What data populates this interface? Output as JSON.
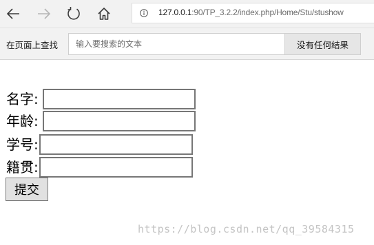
{
  "browser": {
    "url_host": "127.0.0.1",
    "url_rest": ":90/TP_3.2.2/index.php/Home/Stu/stushow"
  },
  "findbar": {
    "label": "在页面上查找",
    "placeholder": "输入要搜索的文本",
    "result": "没有任何结果"
  },
  "form": {
    "name_label": "名字:",
    "age_label": "年龄:",
    "student_id_label": "学号:",
    "hometown_label": "籍贯:",
    "submit_label": "提交"
  },
  "watermark": "https://blog.csdn.net/qq_39584315"
}
